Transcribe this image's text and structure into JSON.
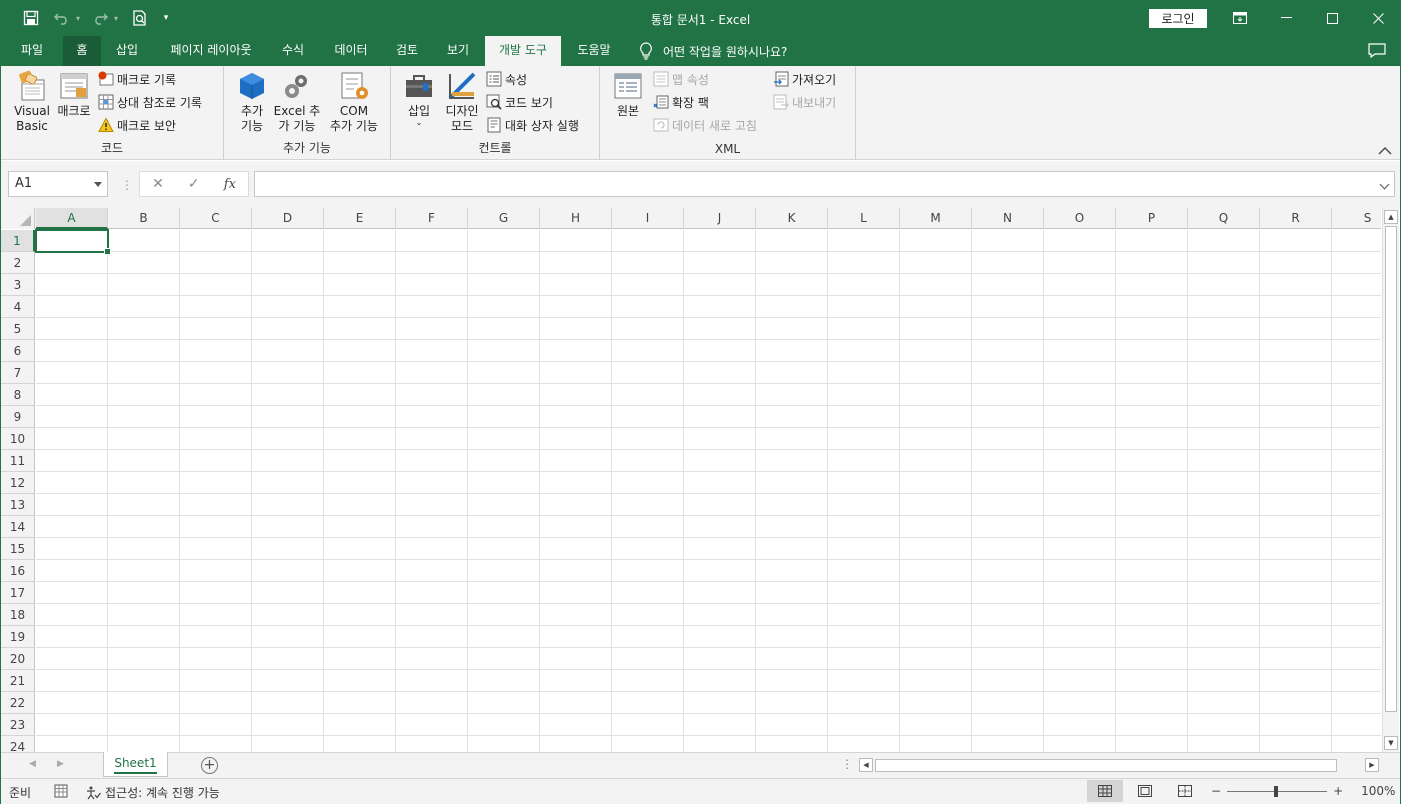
{
  "window": {
    "title": "통합 문서1  -  Excel",
    "login_label": "로그인"
  },
  "tabs": [
    {
      "label": "파일"
    },
    {
      "label": "홈"
    },
    {
      "label": "삽입"
    },
    {
      "label": "페이지 레이아웃"
    },
    {
      "label": "수식"
    },
    {
      "label": "데이터"
    },
    {
      "label": "검토"
    },
    {
      "label": "보기"
    },
    {
      "label": "개발 도구"
    },
    {
      "label": "도움말"
    }
  ],
  "tell_me": "어떤 작업을 원하시나요?",
  "ribbon": {
    "code": {
      "label": "코드",
      "visual_basic": "Visual Basic",
      "visual_basic_l1": "Visual",
      "visual_basic_l2": "Basic",
      "macros": "매크로",
      "record_macro": "매크로 기록",
      "relative_ref": "상대 참조로 기록",
      "macro_security": "매크로 보안"
    },
    "addins": {
      "label": "추가 기능",
      "addins_l1": "추가",
      "addins_l2": "기능",
      "excel_addins_l1": "Excel 추",
      "excel_addins_l2": "가 기능",
      "com_addins_l1": "COM",
      "com_addins_l2": "추가 기능"
    },
    "controls": {
      "label": "컨트롤",
      "insert": "삽입",
      "design_l1": "디자인",
      "design_l2": "모드",
      "properties": "속성",
      "view_code": "코드 보기",
      "run_dialog": "대화 상자 실행"
    },
    "xml": {
      "label": "XML",
      "source": "원본",
      "map_properties": "맵 속성",
      "expansion_packs": "확장 팩",
      "refresh_data": "데이터 새로 고침",
      "import": "가져오기",
      "export": "내보내기"
    }
  },
  "formula_bar": {
    "name_box": "A1",
    "fx": "fx",
    "cancel": "✕",
    "enter": "✓",
    "value": ""
  },
  "columns": [
    "A",
    "B",
    "C",
    "D",
    "E",
    "F",
    "G",
    "H",
    "I",
    "J",
    "K",
    "L",
    "M",
    "N",
    "O",
    "P",
    "Q",
    "R",
    "S"
  ],
  "rows": [
    "1",
    "2",
    "3",
    "4",
    "5",
    "6",
    "7",
    "8",
    "9",
    "10",
    "11",
    "12",
    "13",
    "14",
    "15",
    "16",
    "17",
    "18",
    "19",
    "20",
    "21",
    "22",
    "23",
    "24"
  ],
  "active_cell": "A1",
  "sheets": [
    {
      "label": "Sheet1",
      "active": true
    }
  ],
  "status": {
    "ready": "준비",
    "accessibility": "접근성: 계속 진행 가능",
    "zoom": "100%"
  },
  "colors": {
    "brand": "#217346",
    "ribbon_bg": "#f3f3f3",
    "grid_line": "#e1e1e1"
  }
}
